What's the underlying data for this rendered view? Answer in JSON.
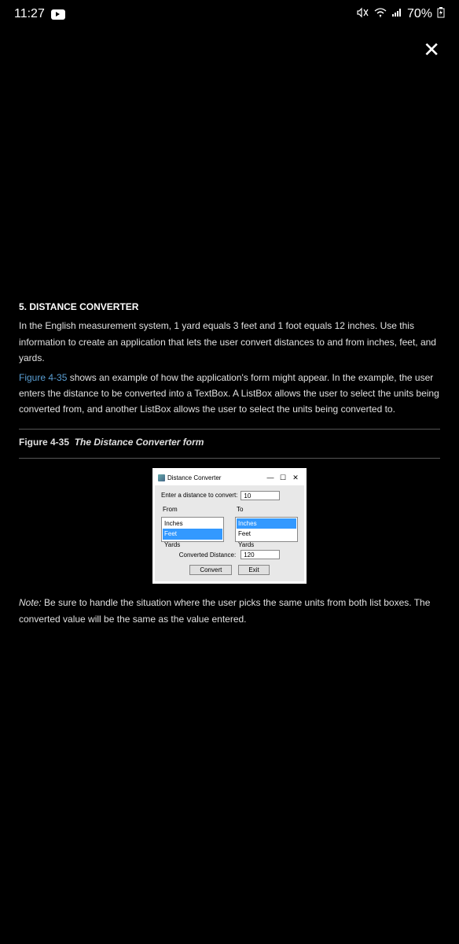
{
  "statusBar": {
    "time": "11:27",
    "battery": "70%",
    "mute": " ",
    "wifi": " ",
    "signal": " ",
    "charging": " "
  },
  "closeGlyph": "✕",
  "problem": {
    "heading": "5. DISTANCE CONVERTER",
    "p1": "In the English measurement system, 1 yard equals 3 feet and 1 foot equals 12 inches. Use this information to create an application that lets the user convert distances to and from inches, feet, and yards.",
    "figRefText": "Figure 4-35",
    "figRefIcon": " ",
    "p2a": " shows an example of how the application's form might appear. In the example, the user enters the distance to be converted into a TextBox. A ListBox allows the user to select the units being converted from, and another ListBox allows the user to select the units being converted to.",
    "figCaptionPrefix": "Figure 4-35",
    "figCaptionTitle": "The Distance Converter form",
    "noteLabel": "Note:",
    "noteText": " Be sure to handle the situation where the user picks the same units from both list boxes. The converted value will be the same as the value entered."
  },
  "window": {
    "title": "Distance Converter",
    "minimize": "—",
    "maximize": "☐",
    "close": "✕",
    "enterLabel": "Enter a distance to convert:",
    "enterValue": "10",
    "fromLabel": "From",
    "toLabel": "To",
    "fromOptions": [
      "Inches",
      "Feet",
      "Yards"
    ],
    "toOptions": [
      "Inches",
      "Feet",
      "Yards"
    ],
    "fromSelectedIndex": 1,
    "toSelectedIndex": 0,
    "convertedLabel": "Converted Distance:",
    "convertedValue": "120",
    "convertBtn": "Convert",
    "exitBtn": "Exit"
  }
}
